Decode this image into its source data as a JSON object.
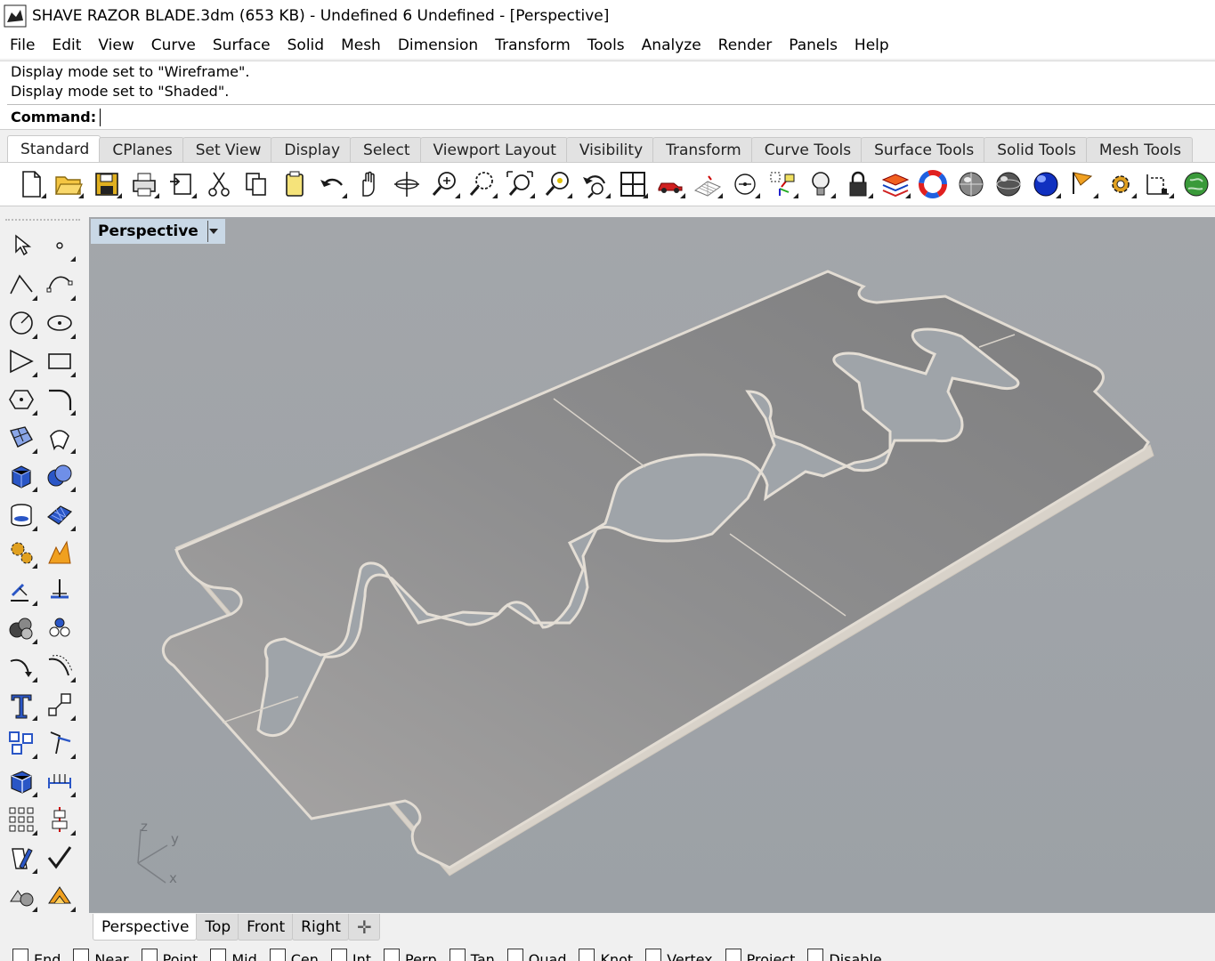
{
  "window": {
    "title": "SHAVE RAZOR BLADE.3dm (653 KB) - Undefined 6 Undefined - [Perspective]"
  },
  "menu": [
    "File",
    "Edit",
    "View",
    "Curve",
    "Surface",
    "Solid",
    "Mesh",
    "Dimension",
    "Transform",
    "Tools",
    "Analyze",
    "Render",
    "Panels",
    "Help"
  ],
  "command": {
    "history": [
      "Display mode set to \"Wireframe\".",
      "Display mode set to \"Shaded\"."
    ],
    "prompt": "Command:",
    "value": ""
  },
  "toolbar_tabs": [
    "Standard",
    "CPlanes",
    "Set View",
    "Display",
    "Select",
    "Viewport Layout",
    "Visibility",
    "Transform",
    "Curve Tools",
    "Surface Tools",
    "Solid Tools",
    "Mesh Tools"
  ],
  "active_toolbar_tab": "Standard",
  "toolbar_icons": [
    "new-file-icon",
    "open-folder-icon",
    "save-icon",
    "print-icon",
    "import-icon",
    "cut-icon",
    "copy-icon",
    "paste-icon",
    "undo-icon",
    "pan-hand-icon",
    "rotate-view-icon",
    "zoom-dynamic-icon",
    "zoom-window-icon",
    "zoom-extents-icon",
    "zoom-selected-icon",
    "undo-view-icon",
    "four-viewports-icon",
    "car-icon",
    "grid-plane-icon",
    "object-snap-icon",
    "gumball-icon",
    "light-bulb-icon",
    "lock-icon",
    "layer-icon",
    "color-wheel-icon",
    "render-sphere-gray-icon",
    "render-sphere-dark-icon",
    "render-sphere-blue-icon",
    "flag-icon",
    "settings-gear-icon",
    "dimension-icon",
    "globe-icon"
  ],
  "left_tools": [
    "select-arrow-icon",
    "point-icon",
    "polyline-icon",
    "curve-icon",
    "circle-icon",
    "ellipse-icon",
    "arc-icon",
    "rectangle-icon",
    "polygon-icon",
    "fillet-curve-icon",
    "surface-from-points-icon",
    "extrude-surface-icon",
    "box-solid-icon",
    "boolean-icon",
    "cylinder-icon",
    "mesh-plane-icon",
    "gear-settings-icon",
    "explode-icon",
    "trim-icon",
    "split-icon",
    "render-spheres-icon",
    "group-icon",
    "curve-drag-icon",
    "offset-curve-icon",
    "text-icon",
    "scale-icon",
    "array-icon",
    "rotate-icon",
    "box-edit-icon",
    "dimension-tool-icon",
    "grid-array-icon",
    "align-icon",
    "bend-icon",
    "check-icon",
    "solid-shapes-icon",
    "analysis-icon"
  ],
  "viewport": {
    "label": "Perspective",
    "axes": {
      "z": "z",
      "y": "y",
      "x": "x"
    }
  },
  "view_tabs": [
    "Perspective",
    "Top",
    "Front",
    "Right"
  ],
  "active_view_tab": "Perspective",
  "colors": {
    "viewport_bg": "#9ea2a7",
    "blade_fill": "#8f8f8f",
    "blade_edge": "#d6d0c8",
    "label_bg": "#c9d8e6"
  },
  "osnaps": [
    "End",
    "Near",
    "Point",
    "Mid",
    "Cen",
    "Int",
    "Perp",
    "Tan",
    "Quad",
    "Knot",
    "Vertex",
    "Project",
    "Disable"
  ]
}
